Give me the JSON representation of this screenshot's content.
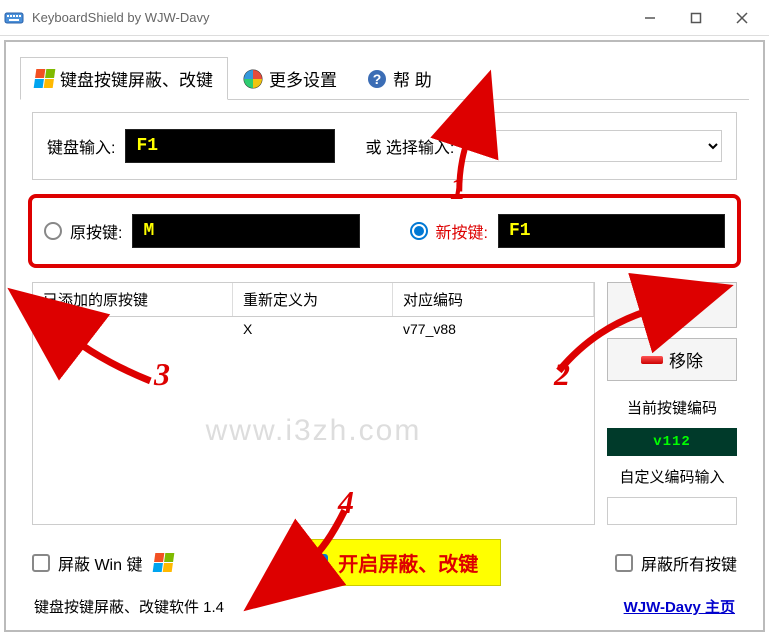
{
  "titlebar": {
    "title": "KeyboardShield by WJW-Davy"
  },
  "tabs": {
    "keymap": "键盘按键屏蔽、改键",
    "more": "更多设置",
    "help": "帮 助"
  },
  "input_row": {
    "kb_label": "键盘输入:",
    "kb_value": "F1",
    "or_label": "或 选择输入:",
    "select_value": "M"
  },
  "keys": {
    "orig_label": "原按键:",
    "orig_value": "M",
    "new_label": "新按键:",
    "new_value": "F1"
  },
  "table": {
    "h0": "已添加的原按键",
    "h1": "重新定义为",
    "h2": "对应编码",
    "row0": {
      "key": "M",
      "remap": "X",
      "code": "v77_v88"
    }
  },
  "side": {
    "add": "添加",
    "remove": "移除",
    "enc_label": "当前按键编码",
    "enc_value": "v112",
    "custom_label": "自定义编码输入"
  },
  "bottom": {
    "block_win": "屏蔽 Win 键",
    "enable": "开启屏蔽、改键",
    "block_all": "屏蔽所有按键"
  },
  "footer": {
    "version": "键盘按键屏蔽、改键软件 1.4",
    "homepage": "WJW-Davy 主页"
  },
  "watermark": "www.i3zh.com",
  "anno": {
    "n1": "1",
    "n2": "2",
    "n3": "3",
    "n4": "4"
  }
}
